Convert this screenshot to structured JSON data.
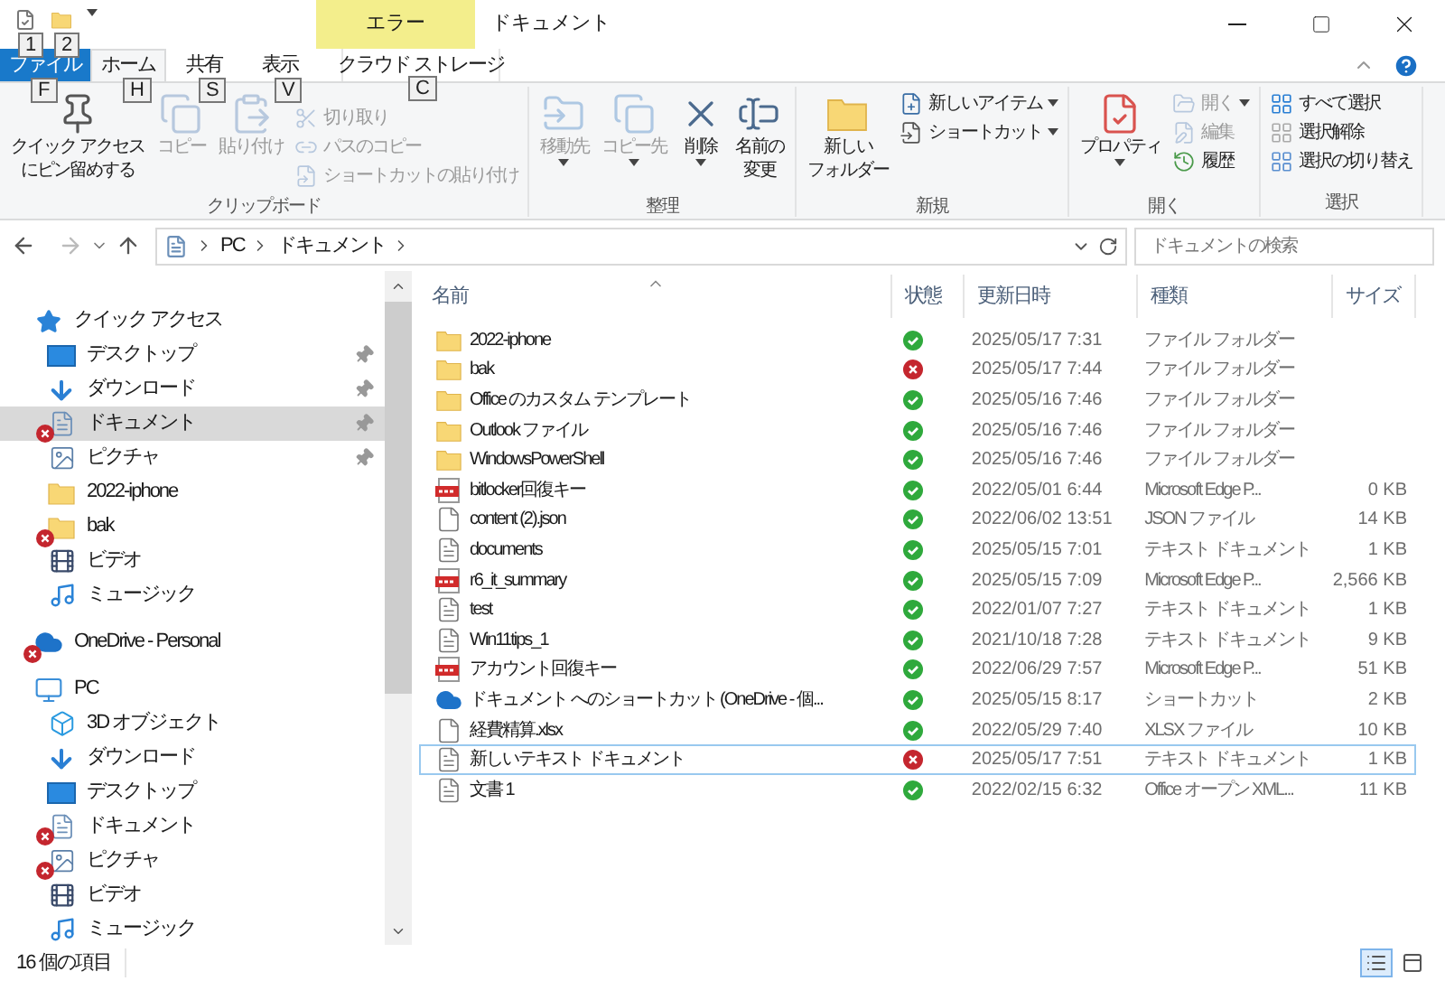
{
  "window": {
    "title": "ドキュメント",
    "context_group": "エラー"
  },
  "quick_access_toolbar": [
    {
      "kind": "properties",
      "keytip": "1"
    },
    {
      "kind": "new-folder",
      "keytip": "2"
    }
  ],
  "ribbon_tabs": [
    {
      "label": "ファイル",
      "keytip": "F",
      "kind": "file",
      "selected": false
    },
    {
      "label": "ホーム",
      "keytip": "H",
      "kind": "tab",
      "selected": true
    },
    {
      "label": "共有",
      "keytip": "S",
      "kind": "tab",
      "selected": false
    },
    {
      "label": "表示",
      "keytip": "V",
      "kind": "tab",
      "selected": false
    },
    {
      "label": "クラウド ストレージ",
      "keytip": "C",
      "kind": "context",
      "selected": false
    }
  ],
  "ribbon_groups": [
    {
      "label": "クリップボード",
      "items": [
        {
          "kind": "large",
          "label": [
            "クイック アクセス",
            "にピン留めする"
          ],
          "disabled": false,
          "dropdown": false
        },
        {
          "kind": "large",
          "label": [
            "コピー"
          ],
          "disabled": true,
          "dropdown": false
        },
        {
          "kind": "large",
          "label": [
            "貼り付け"
          ],
          "disabled": true,
          "dropdown": false
        },
        {
          "kind": "small",
          "label": [
            "切り取り"
          ],
          "disabled": true,
          "dropdown": false
        },
        {
          "kind": "small",
          "label": [
            "パスのコピー"
          ],
          "disabled": true,
          "dropdown": false
        },
        {
          "kind": "small",
          "label": [
            "ショートカットの貼り付け"
          ],
          "disabled": true,
          "dropdown": false
        }
      ]
    },
    {
      "label": "整理",
      "items": [
        {
          "kind": "large",
          "label": [
            "移動先"
          ],
          "disabled": true,
          "dropdown": true
        },
        {
          "kind": "large",
          "label": [
            "コピー先"
          ],
          "disabled": true,
          "dropdown": true
        },
        {
          "kind": "large",
          "label": [
            "削除"
          ],
          "disabled": false,
          "dropdown": true
        },
        {
          "kind": "large",
          "label": [
            "名前の",
            "変更"
          ],
          "disabled": false,
          "dropdown": false
        }
      ]
    },
    {
      "label": "新規",
      "items": [
        {
          "kind": "large",
          "label": [
            "新しい",
            "フォルダー"
          ],
          "disabled": false,
          "dropdown": false
        },
        {
          "kind": "small",
          "label": [
            "新しいアイテム"
          ],
          "disabled": false,
          "dropdown": true
        },
        {
          "kind": "small",
          "label": [
            "ショートカット"
          ],
          "disabled": false,
          "dropdown": true
        }
      ]
    },
    {
      "label": "開く",
      "items": [
        {
          "kind": "large",
          "label": [
            "プロパティ"
          ],
          "disabled": false,
          "dropdown": true
        },
        {
          "kind": "small",
          "label": [
            "開く"
          ],
          "disabled": true,
          "dropdown": true
        },
        {
          "kind": "small",
          "label": [
            "編集"
          ],
          "disabled": true,
          "dropdown": false
        },
        {
          "kind": "small",
          "label": [
            "履歴"
          ],
          "disabled": false,
          "dropdown": false
        }
      ]
    },
    {
      "label": "選択",
      "items": [
        {
          "kind": "small",
          "label": [
            "すべて選択"
          ],
          "disabled": false,
          "dropdown": false
        },
        {
          "kind": "small",
          "label": [
            "選択解除"
          ],
          "disabled": false,
          "dropdown": false
        },
        {
          "kind": "small",
          "label": [
            "選択の切り替え"
          ],
          "disabled": false,
          "dropdown": false
        }
      ]
    }
  ],
  "address": {
    "path": [
      "PC",
      "ドキュメント"
    ]
  },
  "search": {
    "placeholder": "ドキュメントの検索"
  },
  "nav": [
    {
      "label": "クイック アクセス",
      "kind": "star",
      "error": false,
      "pinned": false,
      "selected": false,
      "children": [
        {
          "label": "デスクトップ",
          "kind": "desktop",
          "error": false,
          "pinned": true,
          "selected": false
        },
        {
          "label": "ダウンロード",
          "kind": "download",
          "error": false,
          "pinned": true,
          "selected": false
        },
        {
          "label": "ドキュメント",
          "kind": "document",
          "error": true,
          "pinned": true,
          "selected": true
        },
        {
          "label": "ピクチャ",
          "kind": "picture",
          "error": false,
          "pinned": true,
          "selected": false
        },
        {
          "label": "2022-iphone",
          "kind": "folder",
          "error": false,
          "pinned": false,
          "selected": false
        },
        {
          "label": "bak",
          "kind": "folder",
          "error": true,
          "pinned": false,
          "selected": false
        },
        {
          "label": "ビデオ",
          "kind": "video",
          "error": false,
          "pinned": false,
          "selected": false
        },
        {
          "label": "ミュージック",
          "kind": "music",
          "error": false,
          "pinned": false,
          "selected": false
        }
      ]
    },
    {
      "label": "OneDrive - Personal",
      "kind": "cloud",
      "error": true,
      "pinned": false,
      "selected": false
    },
    {
      "label": "PC",
      "kind": "pc",
      "error": false,
      "pinned": false,
      "selected": false,
      "children": [
        {
          "label": "3D オブジェクト",
          "kind": "cube",
          "error": false,
          "pinned": false,
          "selected": false
        },
        {
          "label": "ダウンロード",
          "kind": "download",
          "error": false,
          "pinned": false,
          "selected": false
        },
        {
          "label": "デスクトップ",
          "kind": "desktop",
          "error": false,
          "pinned": false,
          "selected": false
        },
        {
          "label": "ドキュメント",
          "kind": "document",
          "error": true,
          "pinned": false,
          "selected": false
        },
        {
          "label": "ピクチャ",
          "kind": "picture",
          "error": true,
          "pinned": false,
          "selected": false
        },
        {
          "label": "ビデオ",
          "kind": "video",
          "error": false,
          "pinned": false,
          "selected": false
        },
        {
          "label": "ミュージック",
          "kind": "music",
          "error": false,
          "pinned": false,
          "selected": false
        }
      ]
    }
  ],
  "columns": [
    {
      "label": "名前",
      "sorted": true
    },
    {
      "label": "状態",
      "sorted": false
    },
    {
      "label": "更新日時",
      "sorted": false
    },
    {
      "label": "種類",
      "sorted": false
    },
    {
      "label": "サイズ",
      "sorted": false
    }
  ],
  "files": [
    {
      "name": "2022-iphone",
      "kind": "folder",
      "sync_error": false,
      "date": "2025/05/17 7:31",
      "type": "ファイル フォルダー",
      "selected": false
    },
    {
      "name": "bak",
      "kind": "folder",
      "sync_error": true,
      "date": "2025/05/17 7:44",
      "type": "ファイル フォルダー",
      "selected": false
    },
    {
      "name": "Office のカスタム テンプレート",
      "kind": "folder",
      "sync_error": false,
      "date": "2025/05/16 7:46",
      "type": "ファイル フォルダー",
      "selected": false
    },
    {
      "name": "Outlook ファイル",
      "kind": "folder",
      "sync_error": false,
      "date": "2025/05/16 7:46",
      "type": "ファイル フォルダー",
      "selected": false
    },
    {
      "name": "WindowsPowerShell",
      "kind": "folder",
      "sync_error": false,
      "date": "2025/05/16 7:46",
      "type": "ファイル フォルダー",
      "selected": false
    },
    {
      "name": "bitlocker回復キー",
      "kind": "pdf",
      "sync_error": false,
      "date": "2022/05/01 6:44",
      "type": "Microsoft Edge P...",
      "size": "0 KB",
      "selected": false
    },
    {
      "name": "content (2).json",
      "kind": "file",
      "sync_error": false,
      "date": "2022/06/02 13:51",
      "type": "JSON ファイル",
      "size": "14 KB",
      "selected": false
    },
    {
      "name": "documents",
      "kind": "text",
      "sync_error": false,
      "date": "2025/05/15 7:01",
      "type": "テキスト ドキュメント",
      "size": "1 KB",
      "selected": false
    },
    {
      "name": "r6_it_summary",
      "kind": "pdf",
      "sync_error": false,
      "date": "2025/05/15 7:09",
      "type": "Microsoft Edge P...",
      "size": "2,566 KB",
      "selected": false
    },
    {
      "name": "test",
      "kind": "text",
      "sync_error": false,
      "date": "2022/01/07 7:27",
      "type": "テキスト ドキュメント",
      "size": "1 KB",
      "selected": false
    },
    {
      "name": "Win11tips_1",
      "kind": "text",
      "sync_error": false,
      "date": "2021/10/18 7:28",
      "type": "テキスト ドキュメント",
      "size": "9 KB",
      "selected": false
    },
    {
      "name": "アカウント回復キー",
      "kind": "pdf",
      "sync_error": false,
      "date": "2022/06/29 7:57",
      "type": "Microsoft Edge P...",
      "size": "51 KB",
      "selected": false
    },
    {
      "name": "ドキュメント へのショートカット (OneDrive - 個...",
      "kind": "shortcut",
      "sync_error": false,
      "date": "2025/05/15 8:17",
      "type": "ショートカット",
      "size": "2 KB",
      "selected": false
    },
    {
      "name": "経費精算.xlsx",
      "kind": "file",
      "sync_error": false,
      "date": "2022/05/29 7:40",
      "type": "XLSX ファイル",
      "size": "10 KB",
      "selected": false
    },
    {
      "name": "新しいテキスト ドキュメント",
      "kind": "text",
      "sync_error": true,
      "date": "2025/05/17 7:51",
      "type": "テキスト ドキュメント",
      "size": "1 KB",
      "selected": true
    },
    {
      "name": "文書 1",
      "kind": "text",
      "sync_error": false,
      "date": "2022/02/15 6:32",
      "type": "Office オープン XML...",
      "size": "11 KB",
      "selected": false
    }
  ],
  "status_bar": {
    "item_count": "16 個の項目",
    "views": [
      {
        "kind": "details",
        "selected": true
      },
      {
        "kind": "thumbnails",
        "selected": false
      }
    ]
  }
}
